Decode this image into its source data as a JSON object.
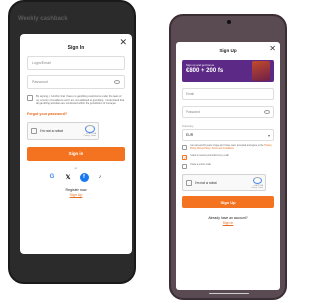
{
  "left": {
    "bg_title": "Weekly cashback",
    "title": "Sign In",
    "login_placeholder": "Login/Email",
    "password_placeholder": "Password",
    "terms_text": "By signing, I Confirm that I have no gambling restrictions under the laws of my country of residence and I am not addicted to gambling. I understand that all gambling activities are conducted within the jurisdiction of Curaçao.",
    "forgot": "Forgot your password?",
    "captcha_label": "I'm not a robot",
    "captcha_brand": "reCAPTCHA",
    "captcha_links": "Privacy - Terms",
    "signin_btn": "Sign in",
    "or": "or",
    "register_q": "Register now",
    "signup_link": "Sign Up"
  },
  "right": {
    "title": "Sign Up",
    "banner_line1": "Sign up and get bonus",
    "banner_line2": "€800 + 200 fs",
    "email_placeholder": "Email",
    "password_placeholder": "Password",
    "currency_label": "Currency",
    "currency_value": "EUR",
    "terms1_a": "I am at least 18 years of age and I have read, accepted and agree to the ",
    "terms1_b": "Privacy Policy, Bonus Policy, Terms and Conditions",
    "terms2": "I want to receive promotions by e-mail",
    "terms3": "I have a promo code",
    "captcha_label": "I'm not a robot",
    "captcha_brand": "reCAPTCHA",
    "captcha_links": "Privacy - Terms",
    "signup_btn": "Sign Up",
    "already": "Already have an account?",
    "login_link": "Sign In"
  },
  "colors": {
    "accent": "#f47321",
    "banner": "#5c2a86"
  }
}
